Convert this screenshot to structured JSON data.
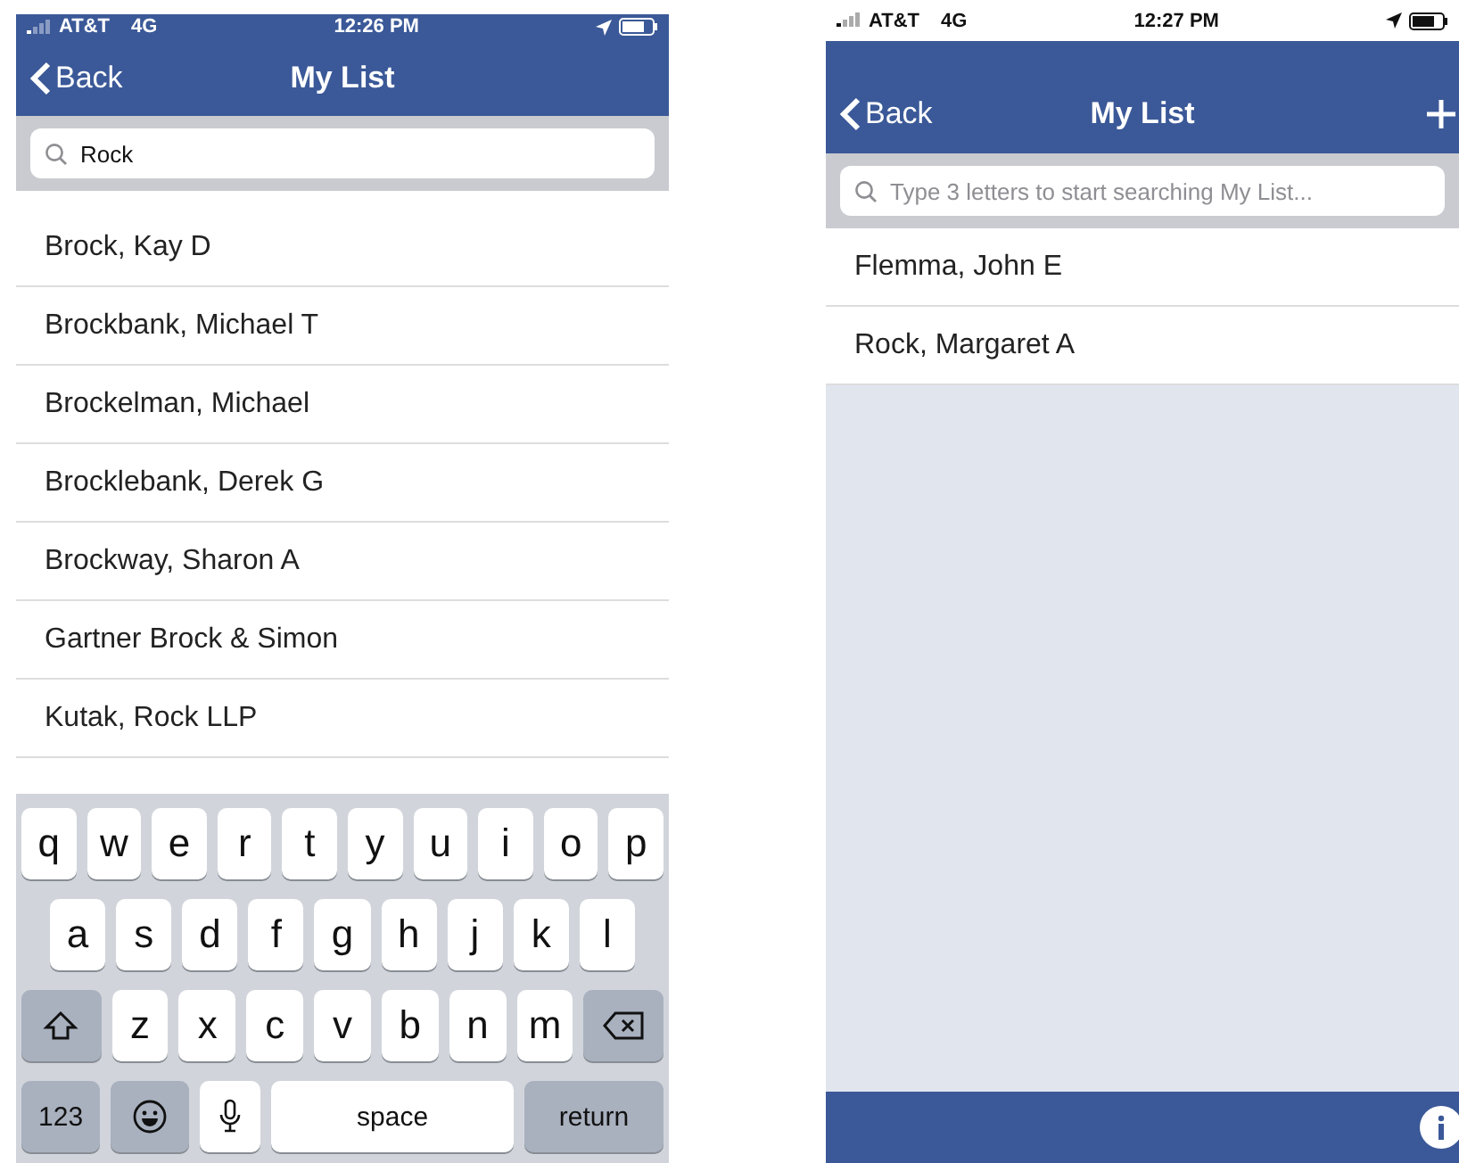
{
  "screens": [
    {
      "status_bar": {
        "carrier": "AT&T",
        "network": "4G",
        "time": "12:26 PM"
      },
      "nav_bar": {
        "back": "Back",
        "title": "My List",
        "add_button": false
      },
      "search": {
        "value": "Rock"
      },
      "rows": [
        "Brock, Kay D",
        "Brockbank, Michael T",
        "Brockelman, Michael",
        "Brocklebank, Derek G",
        "Brockway, Sharon A",
        "Gartner Brock & Simon",
        "Kutak, Rock LLP"
      ],
      "keyboard": {
        "rows": [
          {
            "keys": [
              {
                "kind": "letter",
                "label": "q"
              },
              {
                "kind": "letter",
                "label": "w"
              },
              {
                "kind": "letter",
                "label": "e"
              },
              {
                "kind": "letter",
                "label": "r"
              },
              {
                "kind": "letter",
                "label": "t"
              },
              {
                "kind": "letter",
                "label": "y"
              },
              {
                "kind": "letter",
                "label": "u"
              },
              {
                "kind": "letter",
                "label": "i"
              },
              {
                "kind": "letter",
                "label": "o"
              },
              {
                "kind": "letter",
                "label": "p"
              }
            ]
          },
          {
            "keys": [
              {
                "kind": "letter",
                "label": "a"
              },
              {
                "kind": "letter",
                "label": "s"
              },
              {
                "kind": "letter",
                "label": "d"
              },
              {
                "kind": "letter",
                "label": "f"
              },
              {
                "kind": "letter",
                "label": "g"
              },
              {
                "kind": "letter",
                "label": "h"
              },
              {
                "kind": "letter",
                "label": "j"
              },
              {
                "kind": "letter",
                "label": "k"
              },
              {
                "kind": "letter",
                "label": "l"
              }
            ]
          },
          {
            "keys": [
              {
                "kind": "shift"
              },
              {
                "kind": "letter",
                "label": "z"
              },
              {
                "kind": "letter",
                "label": "x"
              },
              {
                "kind": "letter",
                "label": "c"
              },
              {
                "kind": "letter",
                "label": "v"
              },
              {
                "kind": "letter",
                "label": "b"
              },
              {
                "kind": "letter",
                "label": "n"
              },
              {
                "kind": "letter",
                "label": "m"
              },
              {
                "kind": "delete"
              }
            ]
          },
          {
            "keys": [
              {
                "kind": "mode",
                "label": "123"
              },
              {
                "kind": "emoji"
              },
              {
                "kind": "mic"
              },
              {
                "kind": "space",
                "label": "space"
              },
              {
                "kind": "return",
                "label": "return"
              }
            ]
          }
        ]
      },
      "footer": false
    },
    {
      "status_bar": {
        "carrier": "AT&T",
        "network": "4G",
        "time": "12:27 PM"
      },
      "nav_bar": {
        "back": "Back",
        "title": "My List",
        "add_button": true
      },
      "search": {
        "placeholder": "Type 3 letters to start searching My List..."
      },
      "rows": [
        "Flemma, John E",
        "Rock, Margaret A"
      ],
      "footer": true
    }
  ]
}
